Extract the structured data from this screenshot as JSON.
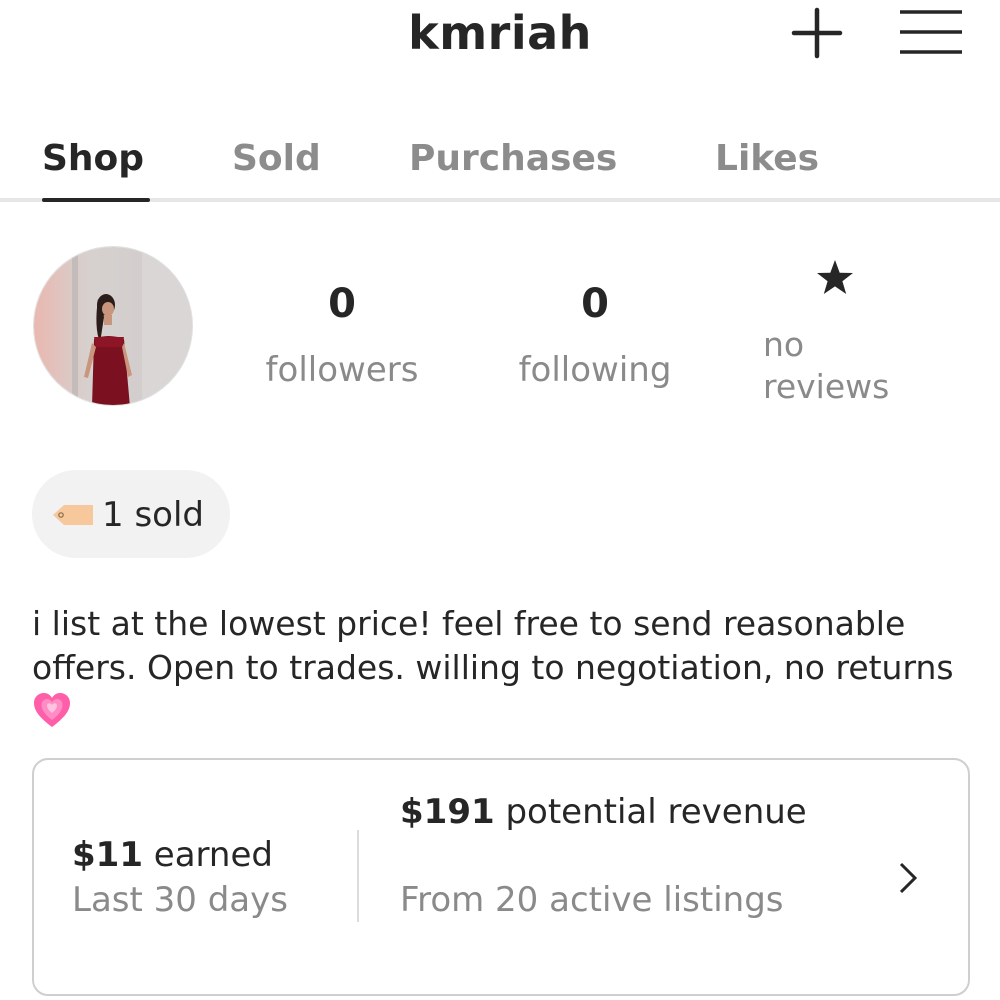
{
  "header": {
    "username": "kmriah",
    "add_icon": "plus-icon",
    "menu_icon": "hamburger-menu-icon"
  },
  "tabs": [
    {
      "label": "Shop",
      "active": true
    },
    {
      "label": "Sold",
      "active": false
    },
    {
      "label": "Purchases",
      "active": false
    },
    {
      "label": "Likes",
      "active": false
    }
  ],
  "profile": {
    "followers_count": "0",
    "followers_label": "followers",
    "following_count": "0",
    "following_label": "following",
    "reviews_icon": "star-icon",
    "reviews_line1": "no",
    "reviews_line2": "reviews"
  },
  "sold_badge": {
    "icon": "price-tag-icon",
    "text": "1 sold"
  },
  "bio": {
    "text": "i list at the lowest price! feel free to send reasonable offers. Open to trades. willing to negotiation, no returns",
    "emoji": "growing-heart-icon"
  },
  "earnings": {
    "earned_amount": "$11",
    "earned_label": "earned",
    "earned_period": "Last 30 days",
    "revenue_amount": "$191",
    "revenue_label": "potential revenue",
    "revenue_source": "From 20 active listings",
    "chevron_icon": "chevron-right-icon"
  },
  "colors": {
    "text_primary": "#262626",
    "text_secondary": "#8a8a8a",
    "divider": "#e6e6e6",
    "pill_bg": "#f2f2f2",
    "heart": "#ff5fa8",
    "tag": "#f6c89c"
  }
}
